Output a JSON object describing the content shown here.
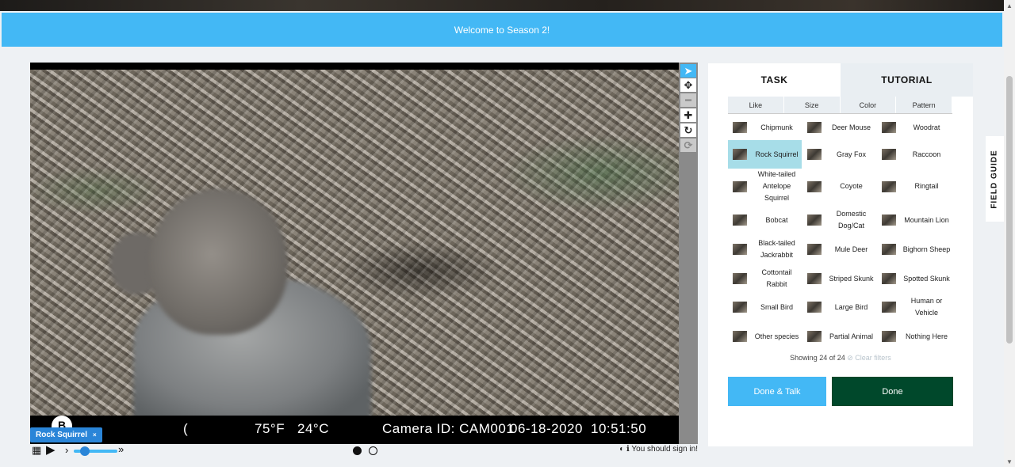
{
  "banner": {
    "text": "Welcome to Season 2!"
  },
  "viewer": {
    "info": {
      "logo": "B",
      "paren": "(",
      "temp_f": "75°F",
      "temp_c": "24°C",
      "camera": "Camera ID: CAM001",
      "date": "06-18-2020",
      "time": "10:51:50"
    },
    "tools": [
      {
        "name": "annotate",
        "icon": "cursor-arrow-icon",
        "glyph": "➤",
        "active": true
      },
      {
        "name": "move",
        "icon": "move-arrows-icon",
        "glyph": "✥"
      },
      {
        "name": "zoom-out",
        "icon": "minus-icon",
        "glyph": "━",
        "disabled": true
      },
      {
        "name": "zoom-in",
        "icon": "plus-icon",
        "glyph": "✚"
      },
      {
        "name": "rotate",
        "icon": "rotate-icon",
        "glyph": "↻"
      },
      {
        "name": "reset",
        "icon": "reset-icon",
        "glyph": "⟳",
        "disabled": true
      }
    ],
    "selected_tag": "Rock Squirrel",
    "tag_close": "×",
    "controls": {
      "grid": "▦",
      "play": "▶",
      "slower": "›",
      "faster": "»"
    },
    "signin": "You should sign in!"
  },
  "panel": {
    "tabs": {
      "task": "TASK",
      "tutorial": "TUTORIAL"
    },
    "filters": [
      "Like",
      "Size",
      "Color",
      "Pattern"
    ],
    "species": [
      [
        "Chipmunk",
        "Deer Mouse",
        "Woodrat"
      ],
      [
        "Rock Squirrel",
        "Gray Fox",
        "Raccoon"
      ],
      [
        "White-tailed Antelope Squirrel",
        "Coyote",
        "Ringtail"
      ],
      [
        "Bobcat",
        "Domestic Dog/Cat",
        "Mountain Lion"
      ],
      [
        "Black-tailed Jackrabbit",
        "Mule Deer",
        "Bighorn Sheep"
      ],
      [
        "Cottontail Rabbit",
        "Striped Skunk",
        "Spotted Skunk"
      ],
      [
        "Small Bird",
        "Large Bird",
        "Human or Vehicle"
      ],
      [
        "Other species",
        "Partial Animal",
        "Nothing Here"
      ]
    ],
    "selected": "Rock Squirrel",
    "showing": "Showing 24 of 24",
    "clear_filters": "⊘ Clear filters",
    "buttons": {
      "done_talk": "Done & Talk",
      "done": "Done"
    }
  },
  "field_guide": "FIELD GUIDE"
}
